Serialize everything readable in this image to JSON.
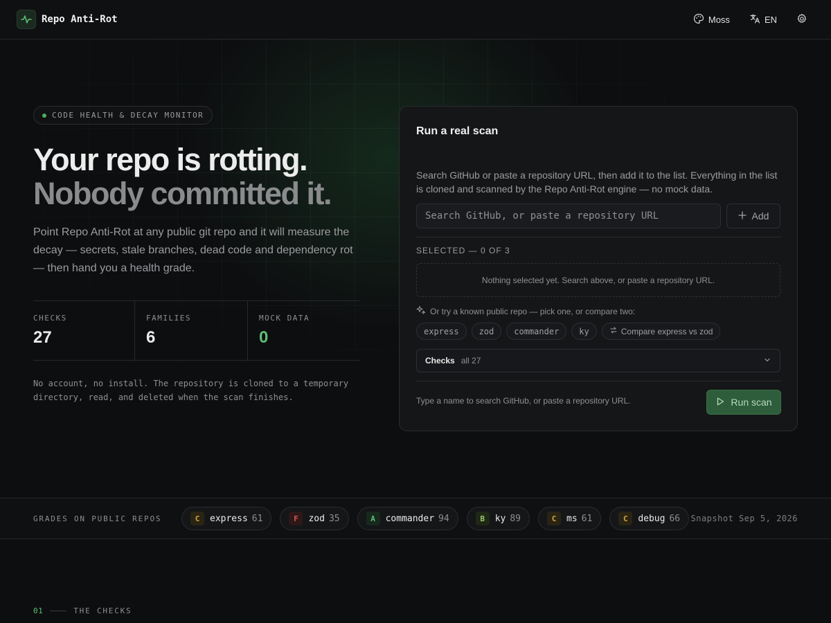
{
  "header": {
    "app_title": "Repo Anti-Rot",
    "theme_label": "Moss",
    "lang_label": "EN"
  },
  "hero": {
    "eyebrow": "CODE HEALTH & DECAY MONITOR",
    "headline_1": "Your repo is rotting.",
    "headline_2": "Nobody committed it.",
    "lead": "Point Repo Anti-Rot at any public git repo and it will measure the decay — secrets, stale branches, dead code and dependency rot — then hand you a health grade.",
    "stats": [
      {
        "label": "CHECKS",
        "value": "27"
      },
      {
        "label": "FAMILIES",
        "value": "6"
      },
      {
        "label": "MOCK DATA",
        "value": "0"
      }
    ],
    "fineprint": "No account, no install. The repository is cloned to a temporary directory, read, and deleted when the scan finishes."
  },
  "scan": {
    "title": "Run a real scan",
    "description": "Search GitHub or paste a repository URL, then add it to the list. Everything in the list is cloned and scanned by the Repo Anti-Rot engine — no mock data.",
    "search_placeholder": "Search GitHub, or paste a repository URL",
    "search_value": "",
    "add_label": "Add",
    "selected_label": "SELECTED — 0 OF 3",
    "empty_text": "Nothing selected yet. Search above, or paste a repository URL.",
    "try_text": "Or try a known public repo — pick one, or compare two:",
    "suggestions": [
      "express",
      "zod",
      "commander",
      "ky"
    ],
    "compare_label": "Compare express vs zod",
    "checks_label": "Checks",
    "checks_value": "all 27",
    "footer_hint": "Type a name to search GitHub, or paste a repository URL.",
    "run_label": "Run scan"
  },
  "grades": {
    "label": "GRADES ON PUBLIC REPOS",
    "items": [
      {
        "grade": "C",
        "name": "express",
        "score": "61",
        "color": "#d9a63a",
        "bg": "#2a2414"
      },
      {
        "grade": "F",
        "name": "zod",
        "score": "35",
        "color": "#d9534f",
        "bg": "#2e1818"
      },
      {
        "grade": "A",
        "name": "commander",
        "score": "94",
        "color": "#5fbf75",
        "bg": "#17291d"
      },
      {
        "grade": "B",
        "name": "ky",
        "score": "89",
        "color": "#9cc46a",
        "bg": "#1f2816"
      },
      {
        "grade": "C",
        "name": "ms",
        "score": "61",
        "color": "#d9a63a",
        "bg": "#2a2414"
      },
      {
        "grade": "C",
        "name": "debug",
        "score": "66",
        "color": "#d9a63a",
        "bg": "#2a2414"
      }
    ],
    "snapshot": "Snapshot Sep 5, 2026"
  },
  "section": {
    "number": "01",
    "title": "THE CHECKS"
  },
  "colors": {
    "accent": "#5fbf75",
    "run_button": "#2d5d3b"
  }
}
